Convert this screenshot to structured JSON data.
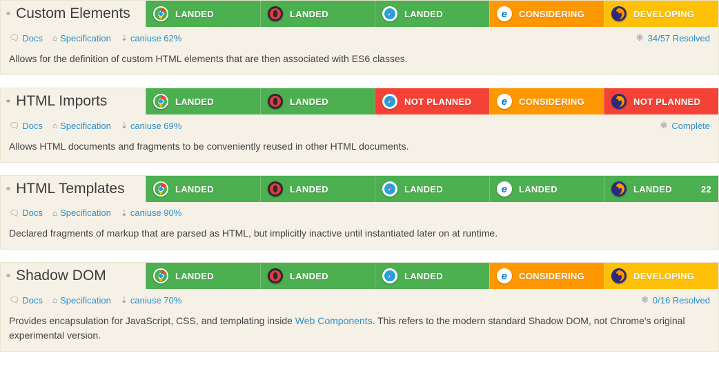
{
  "browsers": [
    "chrome",
    "opera",
    "safari",
    "edge",
    "firefox"
  ],
  "statusClass": {
    "LANDED": "landed",
    "CONSIDERING": "considering",
    "DEVELOPING": "developing",
    "NOT PLANNED": "notplanned"
  },
  "features": [
    {
      "title": "Custom Elements",
      "status": {
        "chrome": "LANDED",
        "opera": "LANDED",
        "safari": "LANDED",
        "edge": "CONSIDERING",
        "firefox": "DEVELOPING"
      },
      "docs_label": "Docs",
      "spec_label": "Specification",
      "caniuse_label": "caniuse 62%",
      "resolved_label": "34/57 Resolved",
      "description_parts": [
        {
          "text": "Allows for the definition of custom HTML elements that are then associated with ES6 classes."
        }
      ]
    },
    {
      "title": "HTML Imports",
      "status": {
        "chrome": "LANDED",
        "opera": "LANDED",
        "safari": "NOT PLANNED",
        "edge": "CONSIDERING",
        "firefox": "NOT PLANNED"
      },
      "docs_label": "Docs",
      "spec_label": "Specification",
      "caniuse_label": "caniuse 69%",
      "resolved_label": "Complete",
      "description_parts": [
        {
          "text": "Allows HTML documents and fragments to be conveniently reused in other HTML documents."
        }
      ]
    },
    {
      "title": "HTML Templates",
      "status": {
        "chrome": "LANDED",
        "opera": "LANDED",
        "safari": "LANDED",
        "edge": "LANDED",
        "firefox": "LANDED"
      },
      "firefox_extra": "22",
      "docs_label": "Docs",
      "spec_label": "Specification",
      "caniuse_label": "caniuse 90%",
      "description_parts": [
        {
          "text": "Declared fragments of markup that are parsed as HTML, but implicitly inactive until instantiated later on at runtime."
        }
      ]
    },
    {
      "title": "Shadow DOM",
      "status": {
        "chrome": "LANDED",
        "opera": "LANDED",
        "safari": "LANDED",
        "edge": "CONSIDERING",
        "firefox": "DEVELOPING"
      },
      "docs_label": "Docs",
      "spec_label": "Specification",
      "caniuse_label": "caniuse 70%",
      "resolved_label": "0/16 Resolved",
      "description_parts": [
        {
          "text": "Provides encapsulation for JavaScript, CSS, and templating inside "
        },
        {
          "text": "Web Components",
          "link": true
        },
        {
          "text": ". This refers to the modern standard Shadow DOM, not Chrome's original experimental version."
        }
      ]
    }
  ]
}
